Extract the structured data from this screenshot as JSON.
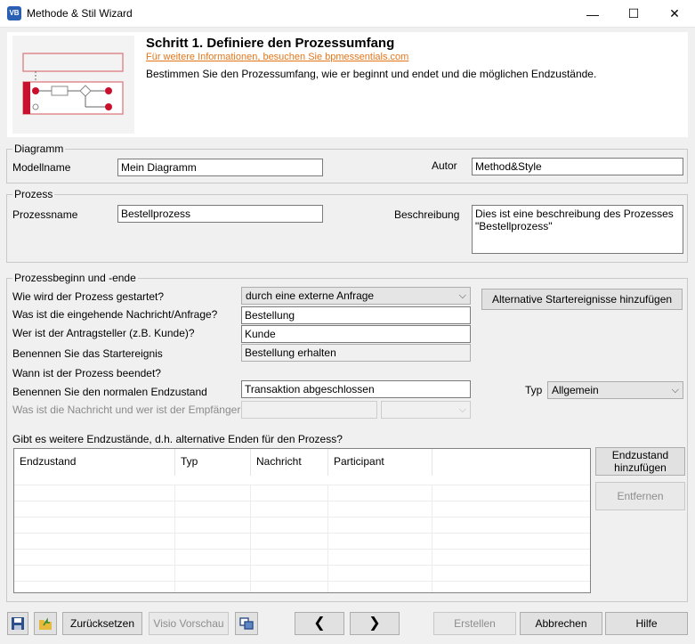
{
  "window": {
    "title": "Methode & Stil Wizard",
    "app_icon_text": "VB",
    "minimize_glyph": "—",
    "maximize_glyph": "☐",
    "close_glyph": "✕"
  },
  "header": {
    "step_title": "Schritt 1. Definiere den Prozessumfang",
    "info_link": "Für weitere Informationen, besuchen Sie bpmessentials.com",
    "description": "Bestimmen Sie den Prozessumfang, wie er beginnt und endet und die möglichen Endzustände.",
    "accent_color": "#c8102e"
  },
  "diagramm": {
    "legend": "Diagramm",
    "modellname_label": "Modellname",
    "modellname_value": "Mein Diagramm",
    "autor_label": "Autor",
    "autor_value": "Method&Style"
  },
  "prozess": {
    "legend": "Prozess",
    "prozessname_label": "Prozessname",
    "prozessname_value": "Bestellprozess",
    "beschreibung_label": "Beschreibung",
    "beschreibung_value": "Dies ist eine beschreibung des Prozesses \"Bestellprozess\""
  },
  "beginn_ende": {
    "legend": "Prozessbeginn und -ende",
    "start_question": "Wie wird der Prozess gestartet?",
    "start_value": "durch eine externe Anfrage",
    "alt_start_button": "Alternative Startereignisse hinzufügen",
    "message_label": "Was ist die eingehende Nachricht/Anfrage?",
    "message_value": "Bestellung",
    "requester_label": "Wer ist der Antragsteller (z.B. Kunde)?",
    "requester_value": "Kunde",
    "start_event_label": "Benennen Sie das Startereignis",
    "start_event_value": "Bestellung erhalten",
    "end_question": "Wann ist der Prozess beendet?",
    "normal_end_label": "Benennen Sie den normalen Endzustand",
    "normal_end_value": "Transaktion abgeschlossen",
    "typ_label": "Typ",
    "typ_value": "Allgemein",
    "recipient_label": "Was ist die Nachricht und wer ist der Empfänger",
    "further_end_question": "Gibt es weitere Endzustände, d.h. alternative Enden für den Prozess?",
    "table_headers": [
      "Endzustand",
      "Typ",
      "Nachricht",
      "Participant",
      ""
    ],
    "add_end_button": "Endzustand hinzufügen",
    "remove_button": "Entfernen"
  },
  "footer": {
    "reset_button": "Zurücksetzen",
    "visio_button": "Visio Vorschau",
    "back_glyph": "❮",
    "next_glyph": "❯",
    "create_button": "Erstellen",
    "cancel_button": "Abbrechen",
    "help_button": "Hilfe"
  }
}
